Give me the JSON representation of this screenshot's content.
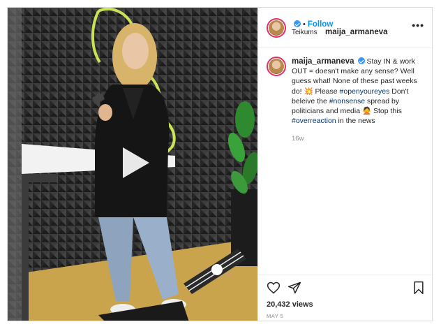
{
  "header": {
    "username": "maija_armaneva",
    "follow_label": "Follow",
    "separator": "•",
    "location": "Teikums",
    "more_label": "•••"
  },
  "caption": {
    "username": "maija_armaneva",
    "seg1": "Stay IN & work OUT = doesn't make any sense? Well guess what! None of these past weeks do! 💥 Please ",
    "tag1": "#openyoureyes",
    "seg2": " Don't beleive the ",
    "tag2": "#nonsense",
    "seg3": " spread by politicians and media 🙅 Stop this ",
    "tag3": "#overreaction",
    "seg4": " in the news",
    "time_ago": "16w"
  },
  "footer": {
    "views": "20,432 views",
    "date": "MAY 5"
  },
  "icons": {
    "heart": "heart-icon",
    "share": "share-icon",
    "save": "bookmark-icon",
    "play": "play-icon",
    "verified": "verified-badge-icon"
  },
  "colors": {
    "accent": "#0095f6",
    "hashtag": "#00376b",
    "verified": "#3897f0",
    "muted": "#8e8e8e"
  }
}
